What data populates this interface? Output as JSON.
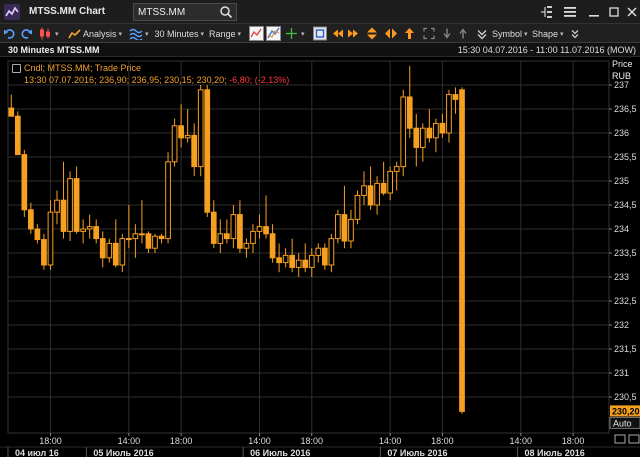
{
  "window": {
    "title": "MTSS.MM Chart",
    "ric_value": "MTSS.MM"
  },
  "toolbar": {
    "analysis_label": "Analysis",
    "interval_label": "30 Minutes",
    "range_label": "Range",
    "symbol_label": "Symbol",
    "shape_label": "Shape"
  },
  "chart_header": {
    "title": "30 Minutes MTSS.MM",
    "range_text": "15:30 04.07.2016 - 11:00 11.07.2016 (MOW)"
  },
  "legend": {
    "line1": "Cndl; MTSS.MM; Trade Price",
    "line2_prefix": "13:30 07.07.2016; 236,90; 236,95; 230,15; 230,20; ",
    "line2_change": "-6,80; (-2,13%)"
  },
  "price_axis": {
    "title": "Price",
    "unit": "RUB",
    "last_price_label": "230,20",
    "auto_label": "Auto"
  },
  "colors": {
    "candle": "#f5a020",
    "candle_edge": "#c87a10",
    "grid": "#2e2e2e",
    "text": "#dddddd",
    "negative": "#ff3b3b",
    "background": "#000000"
  },
  "chart_data": {
    "type": "candlestick",
    "title": "30 Minutes MTSS.MM",
    "ylabel": "Price RUB",
    "ylim": [
      229.75,
      237.5
    ],
    "y_ticks": [
      {
        "value": 237,
        "label": "237"
      },
      {
        "value": 236.5,
        "label": "236,5"
      },
      {
        "value": 236,
        "label": "236"
      },
      {
        "value": 235.5,
        "label": "235,5"
      },
      {
        "value": 235,
        "label": "235"
      },
      {
        "value": 234.5,
        "label": "234,5"
      },
      {
        "value": 234,
        "label": "234"
      },
      {
        "value": 233.5,
        "label": "233,5"
      },
      {
        "value": 233,
        "label": "233"
      },
      {
        "value": 232.5,
        "label": "232,5"
      },
      {
        "value": 232,
        "label": "232"
      },
      {
        "value": 231.5,
        "label": "231,5"
      },
      {
        "value": 231,
        "label": "231"
      },
      {
        "value": 230.5,
        "label": "230,5"
      }
    ],
    "x_time_ticks": [
      {
        "index": 6,
        "label": "18:00"
      },
      {
        "index": 18,
        "label": "14:00"
      },
      {
        "index": 26,
        "label": "18:00"
      },
      {
        "index": 38,
        "label": "14:00"
      },
      {
        "index": 46,
        "label": "18:00"
      },
      {
        "index": 58,
        "label": "14:00"
      },
      {
        "index": 66,
        "label": "18:00"
      },
      {
        "index": 78,
        "label": "14:00"
      },
      {
        "index": 86,
        "label": "18:00"
      }
    ],
    "x_date_ticks": [
      {
        "index": 0,
        "label": "04 июл 16"
      },
      {
        "index": 12,
        "label": "05 Июль 2016"
      },
      {
        "index": 36,
        "label": "06 Июль 2016"
      },
      {
        "index": 57,
        "label": "07 Июль 2016"
      },
      {
        "index": 78,
        "label": "08 Июль 2016"
      }
    ],
    "total_slots": 92,
    "candles": [
      {
        "o": 236.52,
        "h": 236.8,
        "l": 236.35,
        "c": 236.35
      },
      {
        "o": 236.35,
        "h": 236.45,
        "l": 235.55,
        "c": 235.55
      },
      {
        "o": 235.55,
        "h": 235.65,
        "l": 234.25,
        "c": 234.4
      },
      {
        "o": 234.4,
        "h": 234.55,
        "l": 233.9,
        "c": 234.0
      },
      {
        "o": 234.0,
        "h": 234.1,
        "l": 233.7,
        "c": 233.78
      },
      {
        "o": 233.78,
        "h": 233.9,
        "l": 233.15,
        "c": 233.25
      },
      {
        "o": 233.25,
        "h": 234.6,
        "l": 233.15,
        "c": 234.35
      },
      {
        "o": 234.35,
        "h": 234.8,
        "l": 234.1,
        "c": 234.6
      },
      {
        "o": 234.6,
        "h": 235.4,
        "l": 233.8,
        "c": 233.95
      },
      {
        "o": 233.95,
        "h": 235.2,
        "l": 233.75,
        "c": 235.05
      },
      {
        "o": 235.05,
        "h": 235.3,
        "l": 233.9,
        "c": 233.95
      },
      {
        "o": 233.95,
        "h": 234.2,
        "l": 233.7,
        "c": 234.0
      },
      {
        "o": 234.0,
        "h": 234.3,
        "l": 233.8,
        "c": 234.05
      },
      {
        "o": 234.05,
        "h": 234.2,
        "l": 233.7,
        "c": 233.8
      },
      {
        "o": 233.8,
        "h": 233.95,
        "l": 233.2,
        "c": 233.4
      },
      {
        "o": 233.4,
        "h": 233.8,
        "l": 233.3,
        "c": 233.7
      },
      {
        "o": 233.7,
        "h": 234.2,
        "l": 233.2,
        "c": 233.25
      },
      {
        "o": 233.25,
        "h": 233.9,
        "l": 233.1,
        "c": 233.8
      },
      {
        "o": 233.8,
        "h": 234.5,
        "l": 233.6,
        "c": 233.8
      },
      {
        "o": 233.8,
        "h": 234.1,
        "l": 233.4,
        "c": 233.9
      },
      {
        "o": 233.9,
        "h": 234.6,
        "l": 233.7,
        "c": 233.9
      },
      {
        "o": 233.9,
        "h": 233.95,
        "l": 233.5,
        "c": 233.6
      },
      {
        "o": 233.6,
        "h": 233.9,
        "l": 233.5,
        "c": 233.85
      },
      {
        "o": 233.85,
        "h": 233.9,
        "l": 233.7,
        "c": 233.8
      },
      {
        "o": 233.8,
        "h": 235.6,
        "l": 233.7,
        "c": 235.4
      },
      {
        "o": 235.4,
        "h": 236.3,
        "l": 235.3,
        "c": 236.15
      },
      {
        "o": 236.15,
        "h": 236.6,
        "l": 235.7,
        "c": 235.9
      },
      {
        "o": 235.9,
        "h": 236.5,
        "l": 235.8,
        "c": 235.95
      },
      {
        "o": 235.95,
        "h": 236.2,
        "l": 235.1,
        "c": 235.3
      },
      {
        "o": 235.3,
        "h": 237.0,
        "l": 235.1,
        "c": 236.9
      },
      {
        "o": 236.9,
        "h": 237.0,
        "l": 234.25,
        "c": 234.35
      },
      {
        "o": 234.35,
        "h": 234.6,
        "l": 233.6,
        "c": 233.7
      },
      {
        "o": 233.7,
        "h": 234.2,
        "l": 233.5,
        "c": 233.9
      },
      {
        "o": 233.9,
        "h": 234.2,
        "l": 233.7,
        "c": 233.8
      },
      {
        "o": 233.8,
        "h": 234.5,
        "l": 233.6,
        "c": 234.3
      },
      {
        "o": 234.3,
        "h": 234.6,
        "l": 233.5,
        "c": 233.6
      },
      {
        "o": 233.6,
        "h": 233.8,
        "l": 233.4,
        "c": 233.7
      },
      {
        "o": 233.7,
        "h": 234.1,
        "l": 233.5,
        "c": 233.95
      },
      {
        "o": 233.95,
        "h": 234.3,
        "l": 233.8,
        "c": 234.05
      },
      {
        "o": 234.05,
        "h": 234.7,
        "l": 233.8,
        "c": 233.9
      },
      {
        "o": 233.9,
        "h": 234.1,
        "l": 233.3,
        "c": 233.4
      },
      {
        "o": 233.4,
        "h": 233.7,
        "l": 233.1,
        "c": 233.3
      },
      {
        "o": 233.3,
        "h": 233.6,
        "l": 233.2,
        "c": 233.45
      },
      {
        "o": 233.45,
        "h": 233.8,
        "l": 233.1,
        "c": 233.2
      },
      {
        "o": 233.2,
        "h": 233.5,
        "l": 233.0,
        "c": 233.35
      },
      {
        "o": 233.35,
        "h": 233.7,
        "l": 233.1,
        "c": 233.2
      },
      {
        "o": 233.2,
        "h": 233.6,
        "l": 233.0,
        "c": 233.45
      },
      {
        "o": 233.45,
        "h": 233.7,
        "l": 233.3,
        "c": 233.6
      },
      {
        "o": 233.6,
        "h": 233.7,
        "l": 233.15,
        "c": 233.25
      },
      {
        "o": 233.25,
        "h": 233.9,
        "l": 233.1,
        "c": 233.8
      },
      {
        "o": 233.8,
        "h": 234.4,
        "l": 233.7,
        "c": 234.3
      },
      {
        "o": 234.3,
        "h": 234.9,
        "l": 233.6,
        "c": 233.75
      },
      {
        "o": 233.75,
        "h": 234.4,
        "l": 233.6,
        "c": 234.2
      },
      {
        "o": 234.2,
        "h": 234.8,
        "l": 234.1,
        "c": 234.7
      },
      {
        "o": 234.7,
        "h": 235.2,
        "l": 234.5,
        "c": 234.9
      },
      {
        "o": 234.9,
        "h": 235.3,
        "l": 234.4,
        "c": 234.5
      },
      {
        "o": 234.5,
        "h": 235.1,
        "l": 234.3,
        "c": 234.95
      },
      {
        "o": 234.95,
        "h": 235.4,
        "l": 234.7,
        "c": 234.75
      },
      {
        "o": 234.75,
        "h": 235.3,
        "l": 234.6,
        "c": 235.2
      },
      {
        "o": 235.2,
        "h": 235.4,
        "l": 234.8,
        "c": 235.3
      },
      {
        "o": 235.3,
        "h": 236.9,
        "l": 235.1,
        "c": 236.75
      },
      {
        "o": 236.75,
        "h": 237.4,
        "l": 235.9,
        "c": 236.1
      },
      {
        "o": 236.1,
        "h": 236.4,
        "l": 235.3,
        "c": 235.7
      },
      {
        "o": 235.7,
        "h": 236.2,
        "l": 235.4,
        "c": 236.1
      },
      {
        "o": 236.1,
        "h": 236.5,
        "l": 235.8,
        "c": 235.9
      },
      {
        "o": 235.9,
        "h": 236.3,
        "l": 235.6,
        "c": 236.2
      },
      {
        "o": 236.2,
        "h": 236.4,
        "l": 235.9,
        "c": 236.0
      },
      {
        "o": 236.0,
        "h": 236.9,
        "l": 235.8,
        "c": 236.8
      },
      {
        "o": 236.8,
        "h": 236.95,
        "l": 236.4,
        "c": 236.7
      },
      {
        "o": 236.9,
        "h": 236.95,
        "l": 230.15,
        "c": 230.2
      }
    ]
  }
}
